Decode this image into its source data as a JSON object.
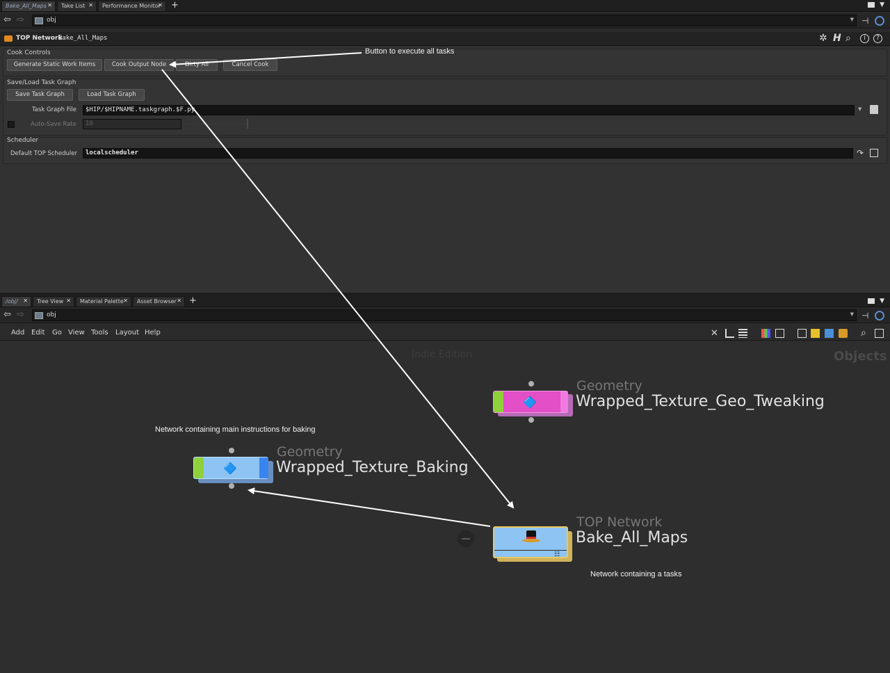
{
  "top_tabs": [
    {
      "label": "Bake_All_Maps",
      "active": true
    },
    {
      "label": "Take List",
      "active": false
    },
    {
      "label": "Performance Monitor",
      "active": false
    }
  ],
  "path_top": {
    "value": "obj"
  },
  "param_header": {
    "node_type": "TOP Network",
    "node_name": "Bake_All_Maps"
  },
  "cook_controls": {
    "title": "Cook Controls",
    "buttons": [
      "Generate Static Work Items",
      "Cook Output Node",
      "Dirty All",
      "Cancel Cook"
    ]
  },
  "save_load": {
    "title": "Save/Load Task Graph",
    "save_label": "Save Task Graph",
    "load_label": "Load Task Graph",
    "task_graph_file_label": "Task Graph File",
    "task_graph_file_value": "$HIP/$HIPNAME.taskgraph.$F.py",
    "autosave_label": "Auto-Save Rate",
    "autosave_value": "10"
  },
  "scheduler": {
    "title": "Scheduler",
    "default_label": "Default TOP Scheduler",
    "default_value": "localscheduler"
  },
  "bottom_tabs": [
    {
      "label": "/obj/",
      "active": true
    },
    {
      "label": "Tree View",
      "active": false
    },
    {
      "label": "Material Palette",
      "active": false
    },
    {
      "label": "Asset Browser",
      "active": false
    }
  ],
  "path_bottom": {
    "value": "obj"
  },
  "menu": [
    "Add",
    "Edit",
    "Go",
    "View",
    "Tools",
    "Layout",
    "Help"
  ],
  "network": {
    "watermark": "Indie Edition",
    "context_label": "Objects",
    "nodes": [
      {
        "type": "Geometry",
        "name": "Wrapped_Texture_Geo_Tweaking",
        "color": "#e04fc2"
      },
      {
        "type": "Geometry",
        "name": "Wrapped_Texture_Baking",
        "color": "#4a9bf0"
      },
      {
        "type": "TOP Network",
        "name": "Bake_All_Maps",
        "color": "#8fc3ef"
      }
    ],
    "annotations": {
      "button_note": "Button to execute all tasks",
      "baking_note": "Network containing main instructions for baking",
      "tasks_note": "Network containing a tasks"
    }
  }
}
